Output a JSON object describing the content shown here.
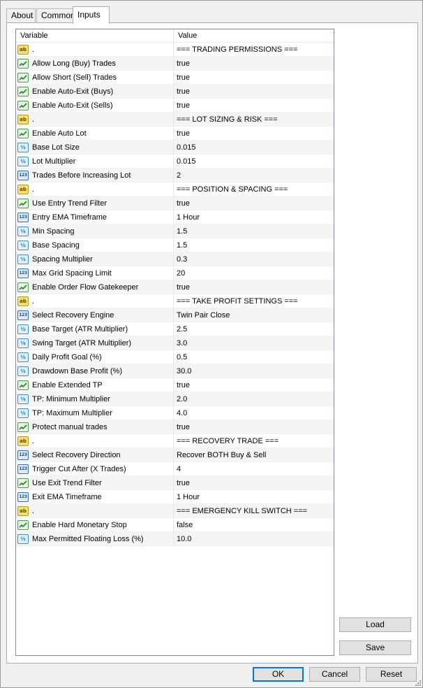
{
  "tabs": [
    {
      "label": "About"
    },
    {
      "label": "Common"
    },
    {
      "label": "Inputs"
    }
  ],
  "grid": {
    "header": {
      "variable": "Variable",
      "value": "Value"
    },
    "rows": [
      {
        "type": "string",
        "icon": "ab-string-icon",
        "icon_text": "ab",
        "variable": ".",
        "value": "=== TRADING PERMISSIONS ==="
      },
      {
        "type": "bool",
        "icon": "bool-icon",
        "variable": "Allow Long (Buy) Trades",
        "value": "true"
      },
      {
        "type": "bool",
        "icon": "bool-icon",
        "variable": "Allow Short (Sell) Trades",
        "value": "true"
      },
      {
        "type": "bool",
        "icon": "bool-icon",
        "variable": "Enable Auto-Exit (Buys)",
        "value": "true"
      },
      {
        "type": "bool",
        "icon": "bool-icon",
        "variable": "Enable Auto-Exit (Sells)",
        "value": "true"
      },
      {
        "type": "string",
        "icon": "ab-string-icon",
        "icon_text": "ab",
        "variable": ".",
        "value": "=== LOT SIZING & RISK ==="
      },
      {
        "type": "bool",
        "icon": "bool-icon",
        "variable": "Enable Auto Lot",
        "value": "true"
      },
      {
        "type": "double",
        "icon": "double-icon",
        "icon_text": "½",
        "variable": "Base Lot Size",
        "value": "0.015"
      },
      {
        "type": "double",
        "icon": "double-icon",
        "icon_text": "½",
        "variable": "Lot Multiplier",
        "value": "0.015"
      },
      {
        "type": "int",
        "icon": "int-icon",
        "icon_text": "123",
        "variable": "Trades Before Increasing Lot",
        "value": "2"
      },
      {
        "type": "string",
        "icon": "ab-string-icon",
        "icon_text": "ab",
        "variable": ".",
        "value": "=== POSITION & SPACING ==="
      },
      {
        "type": "bool",
        "icon": "bool-icon",
        "variable": "Use Entry Trend Filter",
        "value": "true"
      },
      {
        "type": "int",
        "icon": "int-icon",
        "icon_text": "123",
        "variable": "Entry EMA Timeframe",
        "value": "1 Hour"
      },
      {
        "type": "double",
        "icon": "double-icon",
        "icon_text": "½",
        "variable": "Min Spacing",
        "value": "1.5"
      },
      {
        "type": "double",
        "icon": "double-icon",
        "icon_text": "½",
        "variable": "Base Spacing",
        "value": "1.5"
      },
      {
        "type": "double",
        "icon": "double-icon",
        "icon_text": "½",
        "variable": "Spacing Multiplier",
        "value": "0.3"
      },
      {
        "type": "int",
        "icon": "int-icon",
        "icon_text": "123",
        "variable": "Max Grid Spacing Limit",
        "value": "20"
      },
      {
        "type": "bool",
        "icon": "bool-icon",
        "variable": "Enable Order Flow Gatekeeper",
        "value": "true"
      },
      {
        "type": "string",
        "icon": "ab-string-icon",
        "icon_text": "ab",
        "variable": ".",
        "value": "=== TAKE PROFIT SETTINGS ==="
      },
      {
        "type": "int",
        "icon": "int-icon",
        "icon_text": "123",
        "variable": "Select Recovery Engine",
        "value": "Twin Pair Close"
      },
      {
        "type": "double",
        "icon": "double-icon",
        "icon_text": "½",
        "variable": "Base Target (ATR Multiplier)",
        "value": "2.5"
      },
      {
        "type": "double",
        "icon": "double-icon",
        "icon_text": "½",
        "variable": "Swing Target (ATR Multiplier)",
        "value": "3.0"
      },
      {
        "type": "double",
        "icon": "double-icon",
        "icon_text": "½",
        "variable": "Daily Profit Goal (%)",
        "value": "0.5"
      },
      {
        "type": "double",
        "icon": "double-icon",
        "icon_text": "½",
        "variable": "Drawdown Base Profit (%)",
        "value": "30.0"
      },
      {
        "type": "bool",
        "icon": "bool-icon",
        "variable": "Enable Extended TP",
        "value": "true"
      },
      {
        "type": "double",
        "icon": "double-icon",
        "icon_text": "½",
        "variable": "TP: Minimum Multiplier",
        "value": "2.0"
      },
      {
        "type": "double",
        "icon": "double-icon",
        "icon_text": "½",
        "variable": "TP: Maximum Multiplier",
        "value": "4.0"
      },
      {
        "type": "bool",
        "icon": "bool-icon",
        "variable": "Protect manual trades",
        "value": "true"
      },
      {
        "type": "string",
        "icon": "ab-string-icon",
        "icon_text": "ab",
        "variable": ".",
        "value": "=== RECOVERY TRADE ==="
      },
      {
        "type": "int",
        "icon": "int-icon",
        "icon_text": "123",
        "variable": "Select Recovery Direction",
        "value": "Recover BOTH Buy & Sell"
      },
      {
        "type": "int",
        "icon": "int-icon",
        "icon_text": "123",
        "variable": "Trigger Cut After (X Trades)",
        "value": "4"
      },
      {
        "type": "bool",
        "icon": "bool-icon",
        "variable": "Use Exit Trend Filter",
        "value": "true"
      },
      {
        "type": "int",
        "icon": "int-icon",
        "icon_text": "123",
        "variable": "Exit  EMA Timeframe",
        "value": "1 Hour"
      },
      {
        "type": "string",
        "icon": "ab-string-icon",
        "icon_text": "ab",
        "variable": ".",
        "value": "=== EMERGENCY KILL SWITCH ==="
      },
      {
        "type": "bool",
        "icon": "bool-icon",
        "variable": "Enable Hard Monetary Stop",
        "value": "false"
      },
      {
        "type": "double",
        "icon": "double-icon",
        "icon_text": "½",
        "variable": "Max Permitted Floating Loss (%)",
        "value": "10.0"
      }
    ]
  },
  "side_buttons": {
    "load": "Load",
    "save": "Save"
  },
  "footer": {
    "ok": "OK",
    "cancel": "Cancel",
    "reset": "Reset"
  },
  "colors": {
    "accent": "#0078d7",
    "string_icon": "#f3df6f",
    "bool_icon": "#4c9a4a",
    "number_icon": "#3d8fc9"
  }
}
